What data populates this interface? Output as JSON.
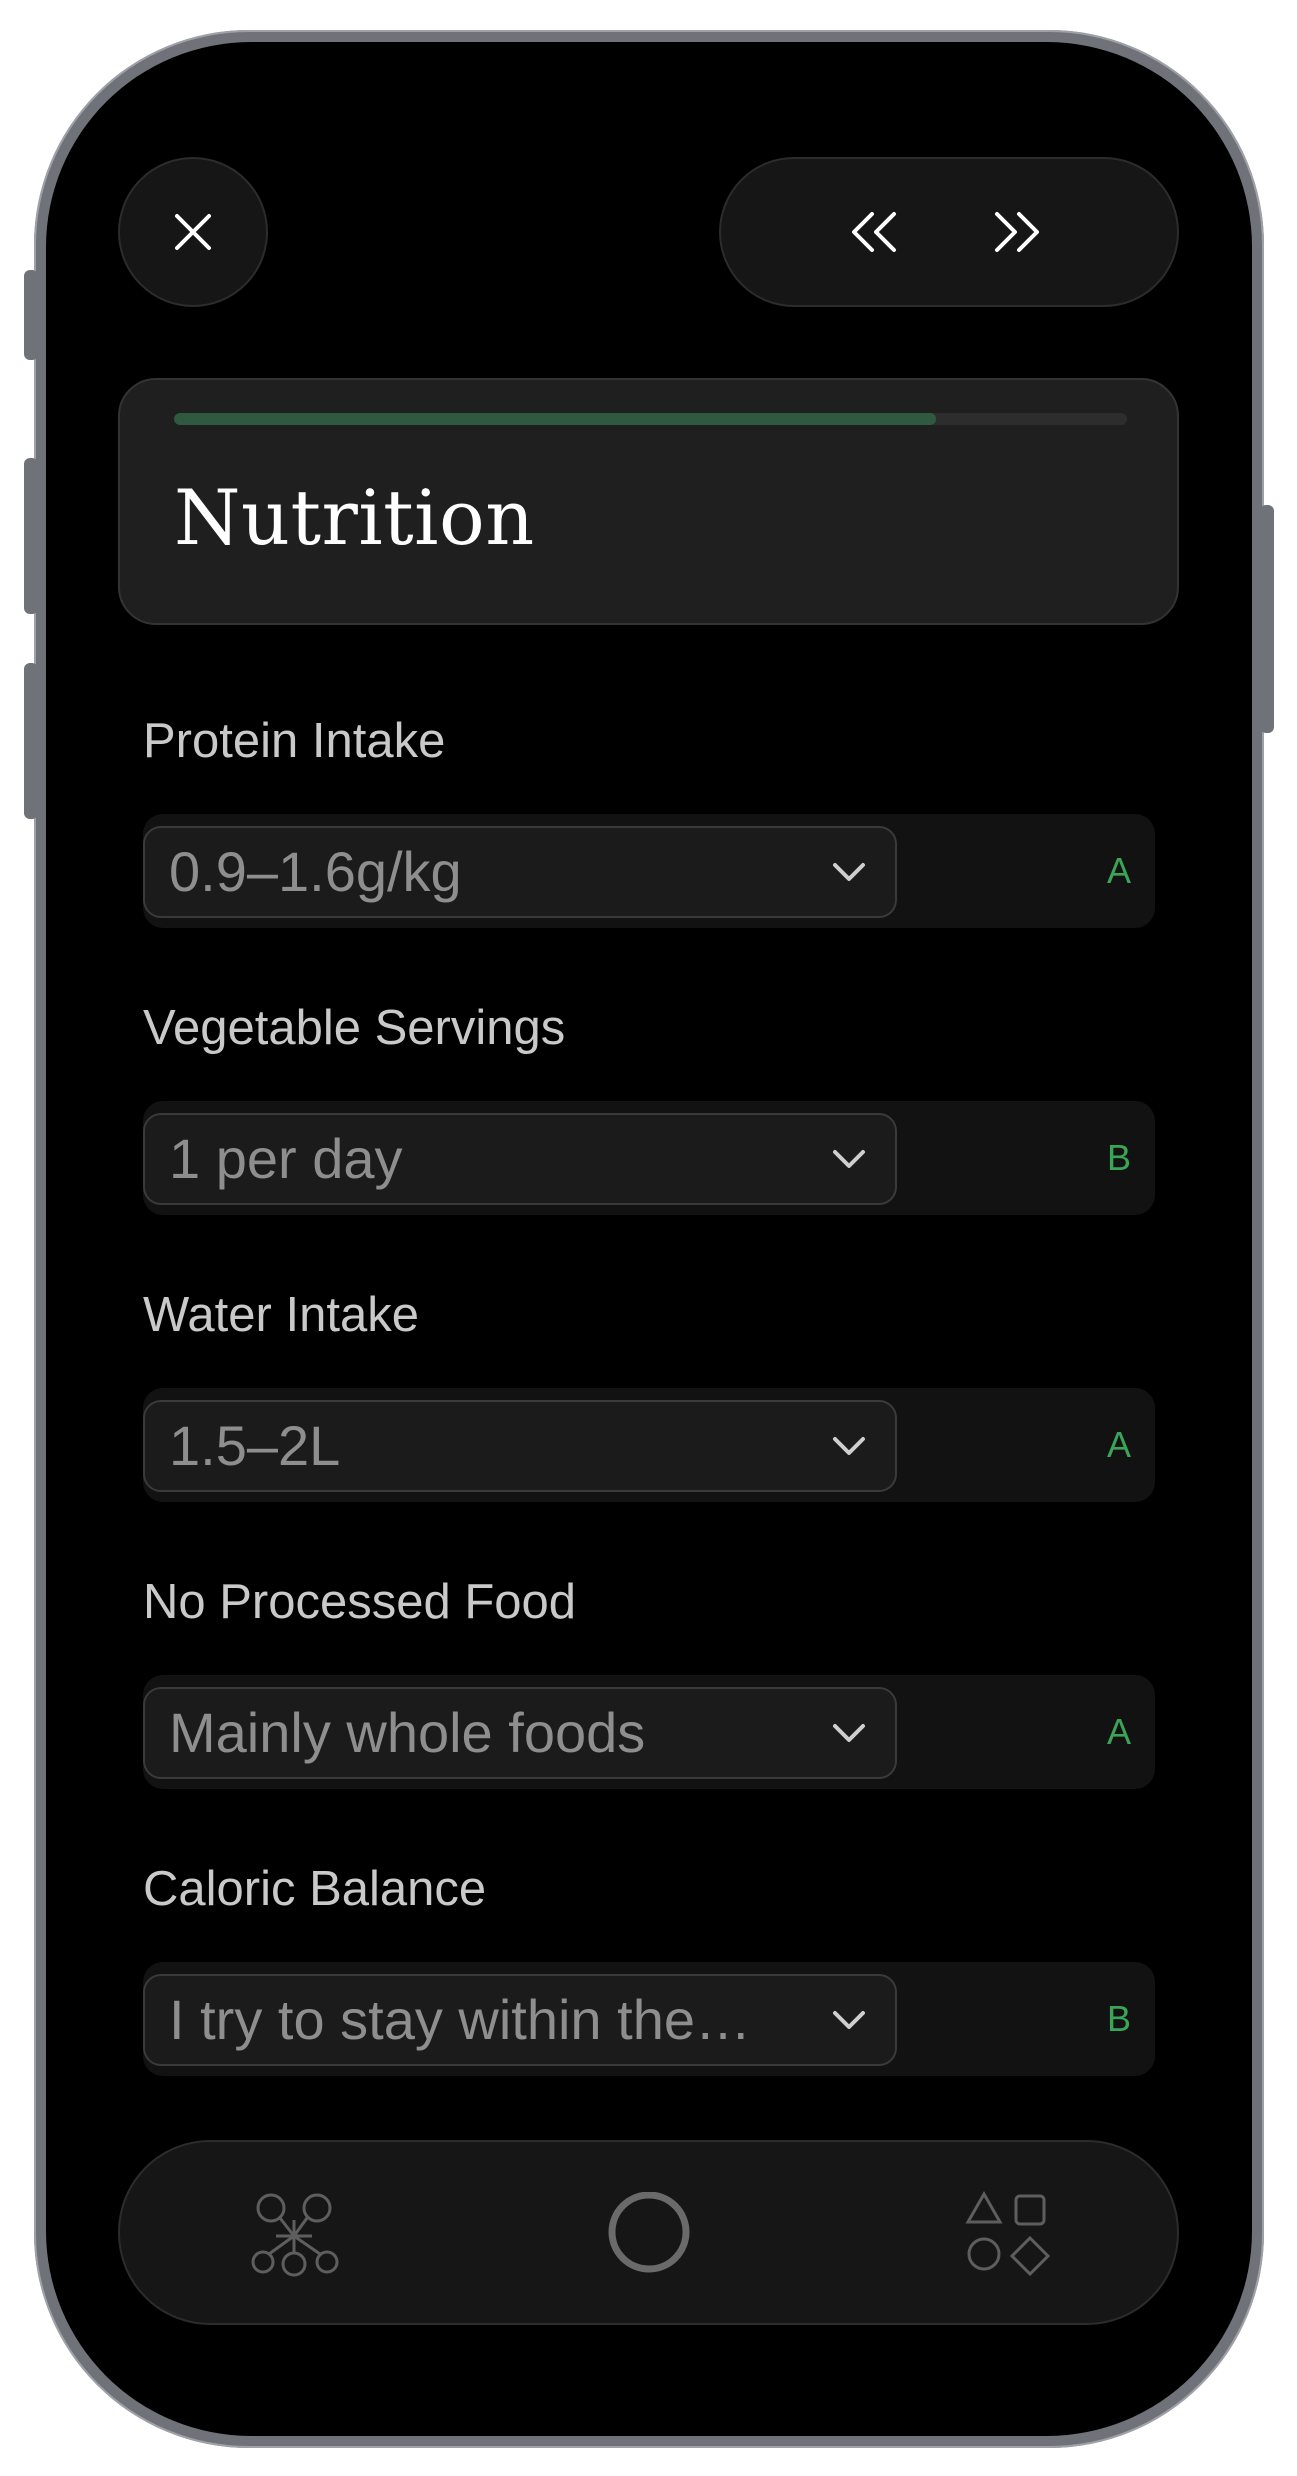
{
  "header": {
    "title": "Nutrition",
    "progress_fraction": 0.8
  },
  "toolbar": {
    "close_icon": "close-icon",
    "prev_icon": "double-chevron-left-icon",
    "next_icon": "double-chevron-right-icon"
  },
  "questions": [
    {
      "label": "Protein Intake",
      "value": "0.9–1.6g/kg",
      "grade": "A"
    },
    {
      "label": "Vegetable Servings",
      "value": "1 per day",
      "grade": "B"
    },
    {
      "label": "Water Intake",
      "value": "1.5–2L",
      "grade": "A"
    },
    {
      "label": "No Processed Food",
      "value": "Mainly whole foods",
      "grade": "A"
    },
    {
      "label": "Caloric Balance",
      "value": "I try to stay within the…",
      "grade": "B"
    }
  ],
  "bottom_nav": {
    "items": [
      {
        "icon": "network-graph-icon"
      },
      {
        "icon": "circle-home-icon"
      },
      {
        "icon": "shapes-icon"
      }
    ]
  },
  "colors": {
    "background": "#000000",
    "accent_green": "#3aa457",
    "progress_fill": "#2f5a3f",
    "card": "#1f1f1f",
    "frame": "#6f7379"
  }
}
